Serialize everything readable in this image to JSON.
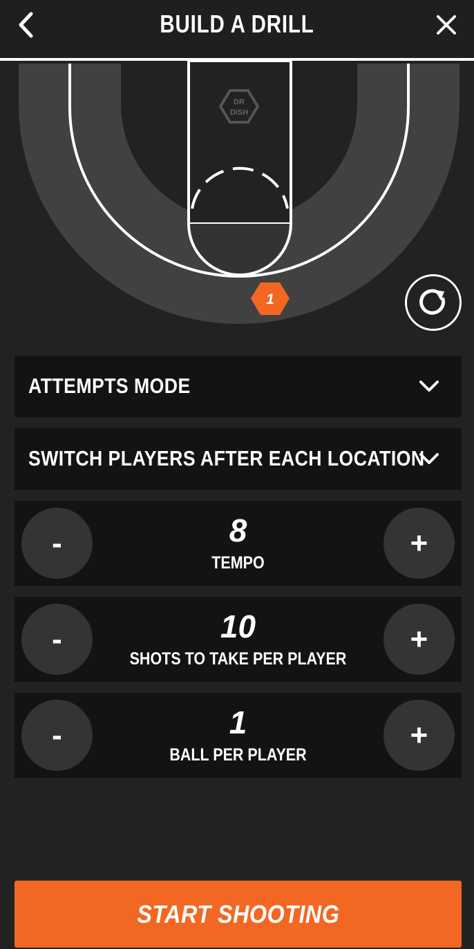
{
  "header": {
    "title": "BUILD A DRILL",
    "back_icon": "chevron-left-icon",
    "close_icon": "close-icon"
  },
  "court": {
    "logo_line1": "DR",
    "logo_line2": "DISH",
    "location_marker": "1",
    "reset_icon": "refresh-icon"
  },
  "dropdowns": [
    {
      "label": "ATTEMPTS MODE",
      "icon": "chevron-down-icon"
    },
    {
      "label": "SWITCH PLAYERS AFTER EACH LOCATION",
      "icon": "chevron-down-icon"
    }
  ],
  "steppers": [
    {
      "value": "8",
      "caption": "TEMPO",
      "minus": "-",
      "plus": "+"
    },
    {
      "value": "10",
      "caption": "SHOTS TO TAKE PER PLAYER",
      "minus": "-",
      "plus": "+"
    },
    {
      "value": "1",
      "caption": "BALL PER PLAYER",
      "minus": "-",
      "plus": "+"
    }
  ],
  "start_button": {
    "label": "START SHOOTING"
  },
  "colors": {
    "accent": "#f26722",
    "background": "#222222",
    "panel": "#131313",
    "button": "#343434"
  }
}
